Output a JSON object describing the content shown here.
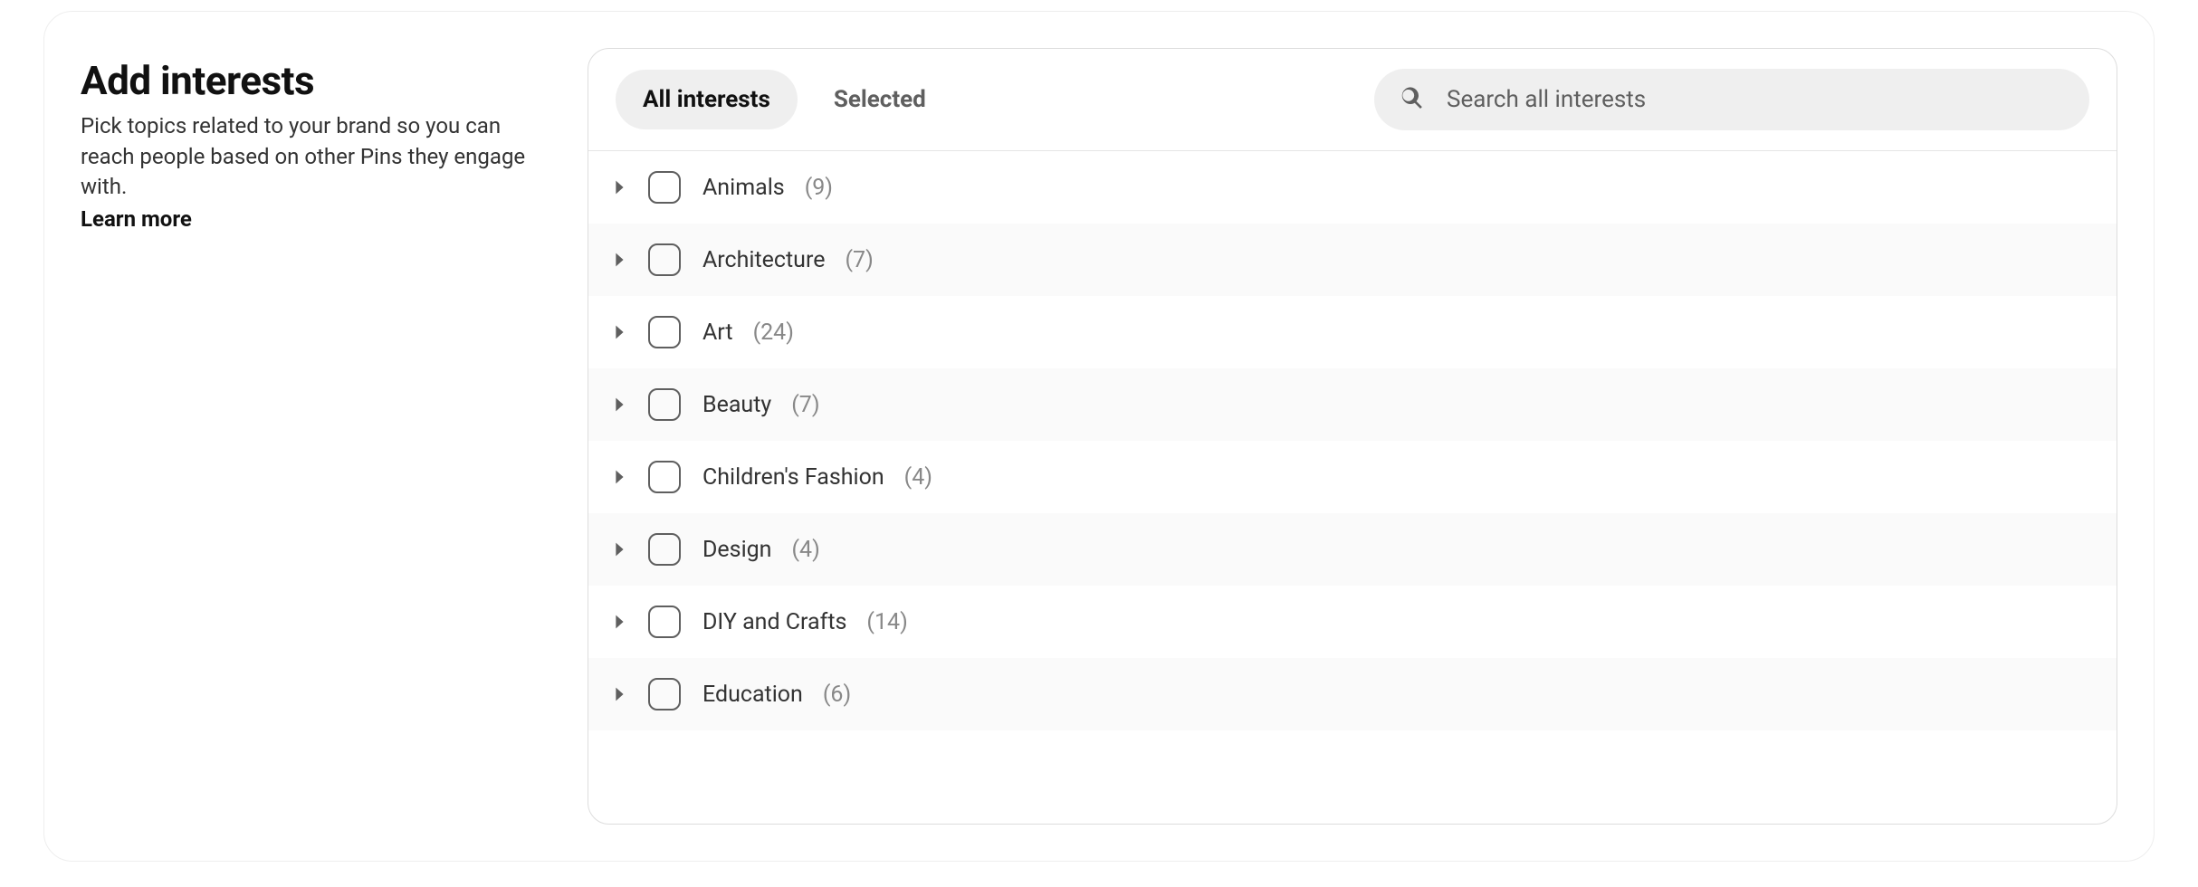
{
  "sidebar": {
    "title": "Add interests",
    "description": "Pick topics related to your brand so you can reach people based on other Pins they engage with.",
    "learn_more": "Learn more"
  },
  "tabs": {
    "all": "All interests",
    "selected": "Selected"
  },
  "search": {
    "placeholder": "Search all interests"
  },
  "interests": [
    {
      "name": "Animals",
      "count": "(9)"
    },
    {
      "name": "Architecture",
      "count": "(7)"
    },
    {
      "name": "Art",
      "count": "(24)"
    },
    {
      "name": "Beauty",
      "count": "(7)"
    },
    {
      "name": "Children's Fashion",
      "count": "(4)"
    },
    {
      "name": "Design",
      "count": "(4)"
    },
    {
      "name": "DIY and Crafts",
      "count": "(14)"
    },
    {
      "name": "Education",
      "count": "(6)"
    }
  ]
}
